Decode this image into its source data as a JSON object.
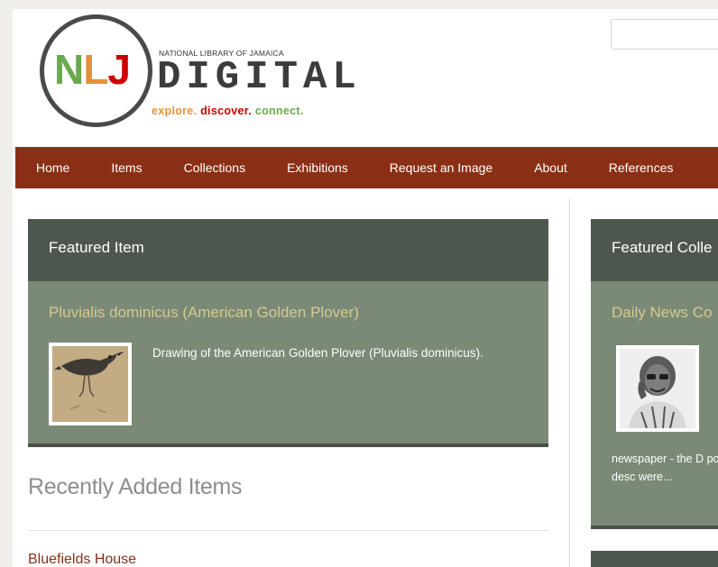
{
  "logo": {
    "letters": [
      "N",
      "L",
      "J"
    ],
    "small_text": "NATIONAL LIBRARY OF JAMAICA",
    "big_text": "DIGITAL",
    "tagline": [
      "explore.",
      "discover.",
      "connect."
    ]
  },
  "search": {
    "placeholder": ""
  },
  "nav": {
    "items": [
      "Home",
      "Items",
      "Collections",
      "Exhibitions",
      "Request an Image",
      "About",
      "References"
    ]
  },
  "featured_item": {
    "heading": "Featured Item",
    "title": "Pluvialis dominicus (American Golden Plover)",
    "description": "Drawing of the American Golden Plover (Pluvialis dominicus).",
    "thumbnail_icon": "bird-drawing-thumbnail"
  },
  "featured_collection": {
    "heading": "Featured Colle",
    "title": "Daily News Co",
    "description": "newspaper - the D possible, the desc were...",
    "thumbnail_icon": "man-portrait-thumbnail"
  },
  "recent": {
    "heading": "Recently Added Items",
    "first_item": "Bluefields House"
  },
  "colors": {
    "nav_bg": "#8a2f15",
    "panel_head": "#4e574d",
    "panel_body": "#7a8a76",
    "panel_title": "#d6c98f"
  }
}
